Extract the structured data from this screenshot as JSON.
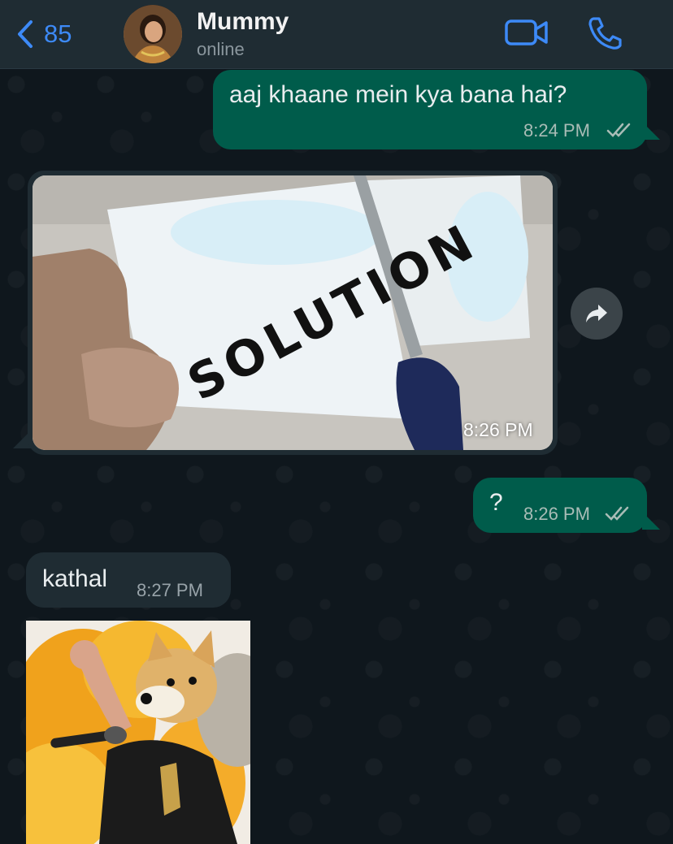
{
  "header": {
    "back_count": "85",
    "contact_name": "Mummy",
    "contact_status": "online"
  },
  "messages": [
    {
      "direction": "out",
      "text": "aaj khaane mein kya bana hai?",
      "time": "8:24 PM",
      "status": "read"
    },
    {
      "direction": "in",
      "type": "image",
      "image_text": "SOLUTION",
      "time": "8:26 PM"
    },
    {
      "direction": "out",
      "text": "?",
      "time": "8:26 PM",
      "status": "read"
    },
    {
      "direction": "in",
      "text": "kathal",
      "time": "8:27 PM"
    },
    {
      "direction": "in",
      "type": "sticker",
      "description": "doge-rockstar-sticker"
    }
  ],
  "colors": {
    "accent": "#3d8af7",
    "outgoing_bubble": "#005c4b",
    "incoming_bubble": "#1f2c33",
    "background": "#0b141a"
  },
  "icons": [
    "chevron-left-icon",
    "video-camera-icon",
    "phone-icon",
    "forward-icon",
    "double-check-icon"
  ]
}
